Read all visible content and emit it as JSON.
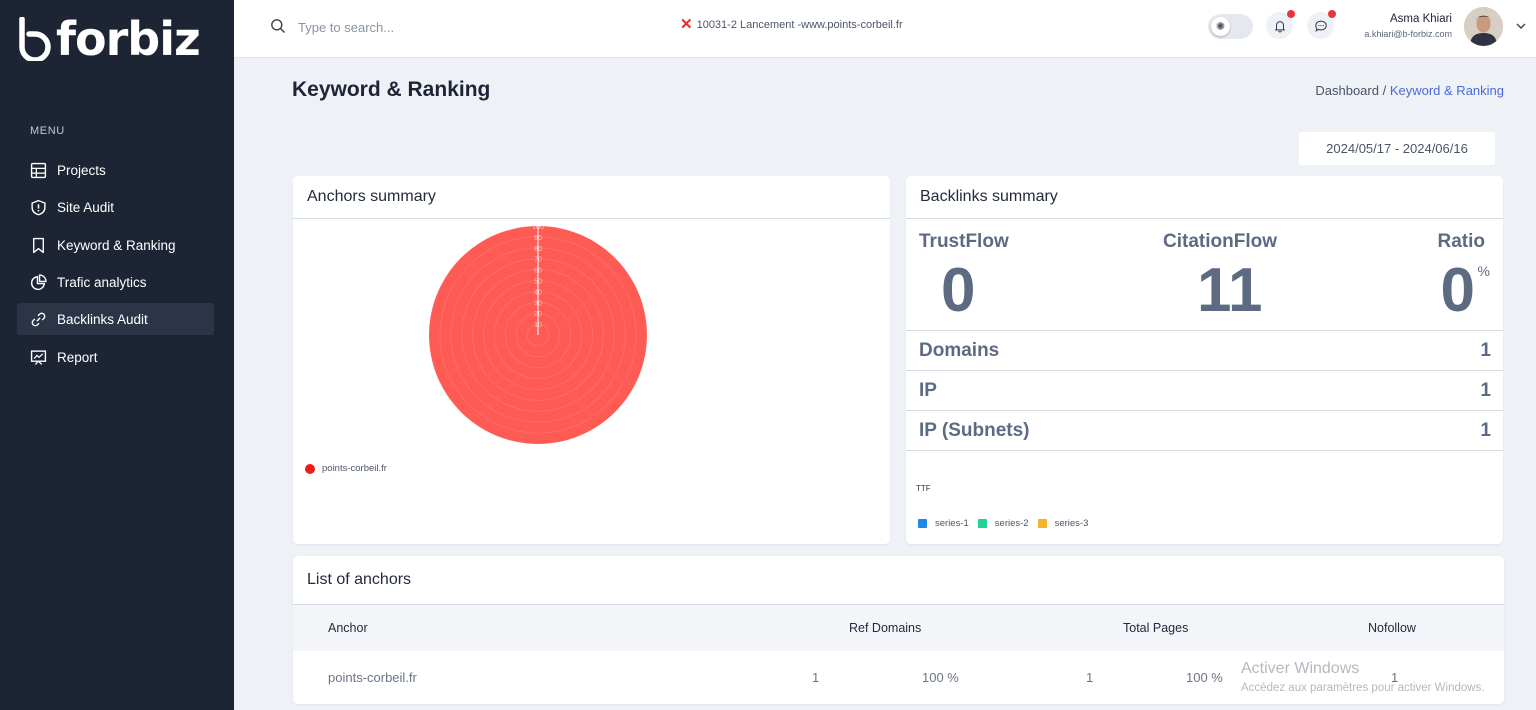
{
  "brand": {
    "logo_text": "forbiz"
  },
  "sidebar": {
    "menu_title": "MENU",
    "items": [
      {
        "label": "Projects",
        "icon": "grid-icon"
      },
      {
        "label": "Site Audit",
        "icon": "shield-icon"
      },
      {
        "label": "Keyword & Ranking",
        "icon": "bookmark-icon"
      },
      {
        "label": "Trafic analytics",
        "icon": "pie-chart-icon"
      },
      {
        "label": "Backlinks Audit",
        "icon": "link-icon",
        "active": true
      },
      {
        "label": "Report",
        "icon": "presentation-chart-icon"
      }
    ]
  },
  "topbar": {
    "search_placeholder": "Type to search...",
    "project": "10031-2 Lancement -www.points-corbeil.fr",
    "user_name": "Asma Khiari",
    "user_email": "a.khiari@b-forbiz.com"
  },
  "page": {
    "title": "Keyword & Ranking",
    "breadcrumb_root": "Dashboard /",
    "breadcrumb_current": "Keyword & Ranking",
    "date_range": "2024/05/17 - 2024/06/16"
  },
  "anchors_summary": {
    "title": "Anchors summary",
    "legend": [
      {
        "label": "points-corbeil.fr",
        "color": "#ec1c1c"
      }
    ]
  },
  "chart_data": {
    "type": "pie",
    "categories": [
      "points-corbeil.fr"
    ],
    "values": [
      100
    ],
    "colors": [
      "#ff5b55"
    ],
    "radial_ticks": [
      "10",
      "20",
      "30",
      "40",
      "50",
      "60",
      "70",
      "80",
      "90",
      "100"
    ]
  },
  "backlinks_summary": {
    "title": "Backlinks summary",
    "trustflow_label": "TrustFlow",
    "trustflow_value": "0",
    "citationflow_label": "CitationFlow",
    "citationflow_value": "11",
    "ratio_label": "Ratio",
    "ratio_value": "0",
    "ratio_unit": "%",
    "rows": [
      {
        "label": "Domains",
        "value": "1"
      },
      {
        "label": "IP",
        "value": "1"
      },
      {
        "label": "IP (Subnets)",
        "value": "1"
      }
    ],
    "ttf_label": "TTF",
    "series": [
      {
        "name": "series-1",
        "color": "#1e88e5"
      },
      {
        "name": "series-2",
        "color": "#1ed39a"
      },
      {
        "name": "series-3",
        "color": "#f9b12b"
      }
    ]
  },
  "anchors_list": {
    "title": "List of anchors",
    "columns": [
      "Anchor",
      "Ref Domains",
      "Total Pages",
      "Nofollow"
    ],
    "rows": [
      {
        "anchor": "points-corbeil.fr",
        "ref_domains": "1",
        "ref_domains_pct": "100 %",
        "total_pages": "1",
        "total_pages_pct": "100 %",
        "nofollow": "1"
      }
    ]
  },
  "watermark": {
    "line1": "Activer Windows",
    "line2": "Accédez aux paramètres pour activer Windows."
  }
}
